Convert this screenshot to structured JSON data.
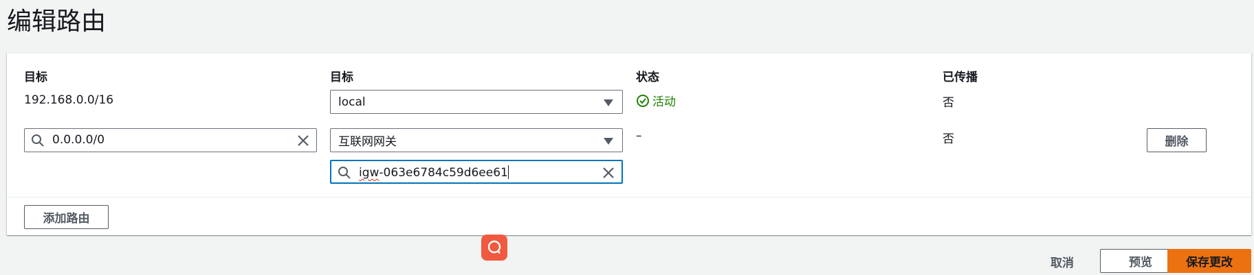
{
  "page": {
    "title": "编辑路由"
  },
  "table": {
    "headers": {
      "destination": "目标",
      "target": "目标",
      "status": "状态",
      "propagated": "已传播"
    },
    "rows": [
      {
        "destination": "192.168.0.0/16",
        "target": "local",
        "status": "活动",
        "propagated": "否"
      },
      {
        "destination": "0.0.0.0/0",
        "target": "互联网网关",
        "target_search_value_prefix": "igw",
        "target_search_value_rest": "-063e6784c59d6ee61",
        "status": "–",
        "propagated": "否",
        "remove_label": "删除"
      }
    ],
    "add_route_label": "添加路由"
  },
  "footer": {
    "cancel_label": "取消",
    "preview_label": "预览",
    "save_label": "保存更改"
  },
  "colors": {
    "status_active": "#1d8102",
    "primary": "#ec7211",
    "focus": "#0073bb",
    "float_button": "#f05a40"
  },
  "icons": {
    "status": "check-circle-icon",
    "search": "search-icon",
    "clear": "close-icon",
    "dropdown": "caret-down-icon",
    "float": "chat-bubble-icon"
  }
}
